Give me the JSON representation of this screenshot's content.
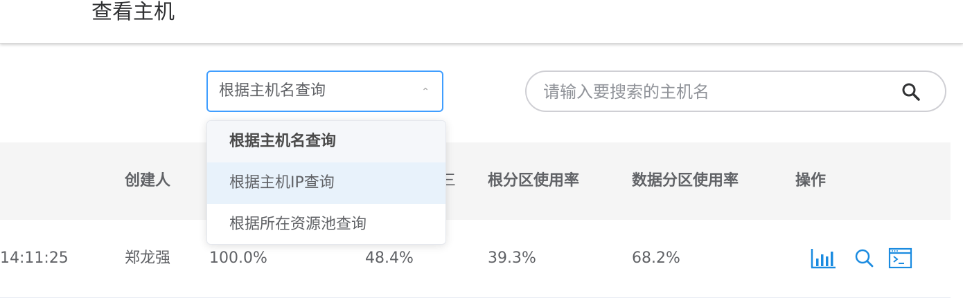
{
  "header": {
    "title": "查看主机"
  },
  "filter": {
    "selected": "根据主机名查询",
    "arrow": "⌃",
    "options": [
      "根据主机名查询",
      "根据主机IP查询",
      "根据所在资源池查询"
    ]
  },
  "search": {
    "placeholder": "请输入要搜索的主机名",
    "value": ""
  },
  "table": {
    "columns": [
      "创建人",
      "根分区使用率",
      "数据分区使用率",
      "操作"
    ],
    "hidden_col_tail": "三",
    "rows": [
      {
        "time_fragment": "14:11:25",
        "creator": "郑龙强",
        "val1": "100.0%",
        "val2": "48.4%",
        "root_usage": "39.3%",
        "data_usage": "68.2%",
        "actions": [
          "bar-chart-icon",
          "search-icon",
          "terminal-icon"
        ]
      }
    ]
  },
  "colors": {
    "accent": "#409eff",
    "icon_blue": "#1a8be0",
    "header_bg": "#f5f5f5"
  }
}
